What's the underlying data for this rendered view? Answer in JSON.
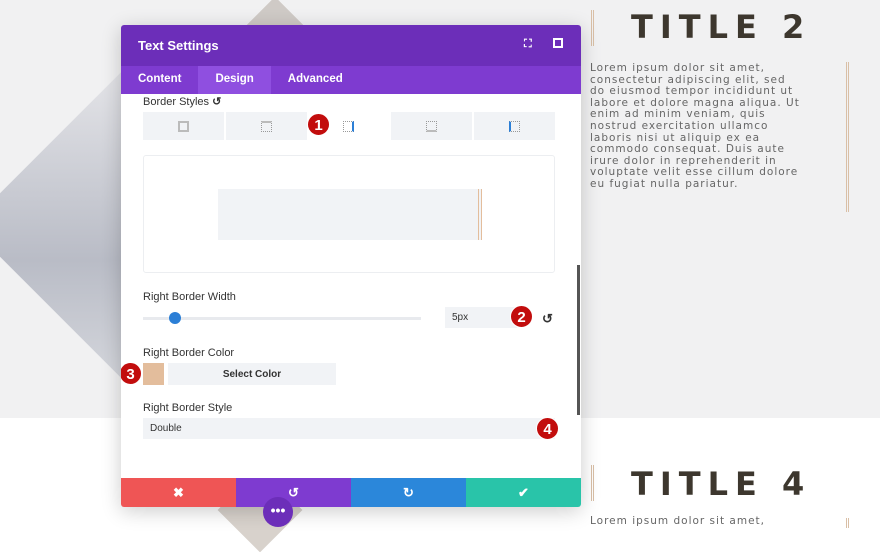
{
  "background": {
    "title2": "TITLE 2",
    "title4": "TITLE 4",
    "lorem": "Lorem ipsum dolor sit amet, consectetur adipiscing elit, sed do eiusmod tempor incididunt ut labore et dolore magna aliqua. Ut enim ad minim veniam, quis nostrud exercitation ullamco laboris nisi ut aliquip ex ea commodo consequat. Duis aute irure dolor in reprehenderit in voluptate velit esse cillum dolore eu fugiat nulla pariatur.",
    "lorem2": "Lorem ipsum dolor sit amet,"
  },
  "modal": {
    "title": "Text Settings",
    "tabs": [
      {
        "label": "Content"
      },
      {
        "label": "Design",
        "active": true
      },
      {
        "label": "Advanced"
      }
    ],
    "border_styles_label": "Border Styles",
    "border_style_options": [
      "all",
      "top",
      "right",
      "bottom",
      "left"
    ],
    "selected_border_side": "right",
    "right_border_width_label": "Right Border Width",
    "right_border_width_value": "5px",
    "right_border_width_slider_percent": 12,
    "right_border_color_label": "Right Border Color",
    "right_border_color": "#e3bd9c",
    "select_color_label": "Select Color",
    "right_border_style_label": "Right Border Style",
    "right_border_style_value": "Double",
    "footer": {
      "cancel": "✖",
      "undo": "↺",
      "redo": "↻",
      "save": "✔"
    },
    "colors": {
      "header": "#6c2eb9",
      "tabs": "#7e3bd0",
      "cancel": "#ef5555",
      "undo": "#7e3bd0",
      "redo": "#2b87da",
      "save": "#29c4a9"
    }
  },
  "annotations": [
    "1",
    "2",
    "3",
    "4"
  ],
  "more_button": "•••"
}
